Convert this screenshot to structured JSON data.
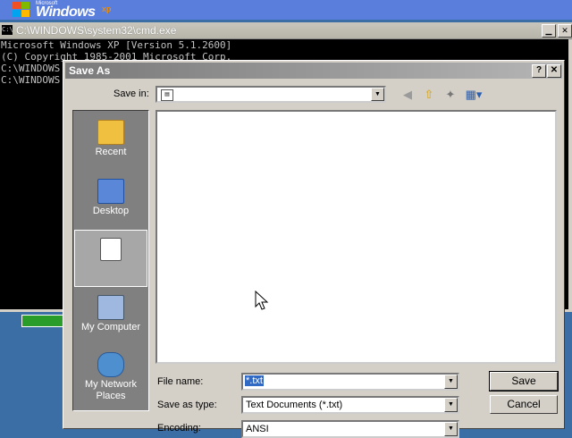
{
  "desktop": {
    "logo_small": "Microsoft",
    "logo_big": "Windows",
    "logo_xp": "xp"
  },
  "cmd": {
    "title": "C:\\WINDOWS\\system32\\cmd.exe",
    "icon_text": "C:\\",
    "lines": [
      "Microsoft Windows XP [Version 5.1.2600]",
      "(C) Copyright 1985-2001 Microsoft Corp.",
      "",
      "C:\\WINDOWS",
      "",
      "C:\\WINDOWS"
    ]
  },
  "dialog": {
    "title": "Save As",
    "help_label": "?",
    "close_label": "✕",
    "save_in_label": "Save in:",
    "save_in_value": "",
    "places": [
      {
        "label": "Recent"
      },
      {
        "label": "Desktop"
      },
      {
        "label": ""
      },
      {
        "label": "My Computer"
      },
      {
        "label": "My Network Places"
      }
    ],
    "file_name_label": "File name:",
    "file_name_value": "*.txt",
    "save_as_type_label": "Save as type:",
    "save_as_type_value": "Text Documents (*.txt)",
    "encoding_label": "Encoding:",
    "encoding_value": "ANSI",
    "save_button": "Save",
    "cancel_button": "Cancel"
  },
  "icons": {
    "back": "back-arrow-icon",
    "up": "up-folder-icon",
    "new_folder": "new-folder-icon",
    "views": "views-menu-icon"
  },
  "colors": {
    "desktop_bg": "#3a6ea5",
    "dialog_face": "#d4d0c8",
    "console_bg": "#000000",
    "selection": "#316ac5"
  }
}
